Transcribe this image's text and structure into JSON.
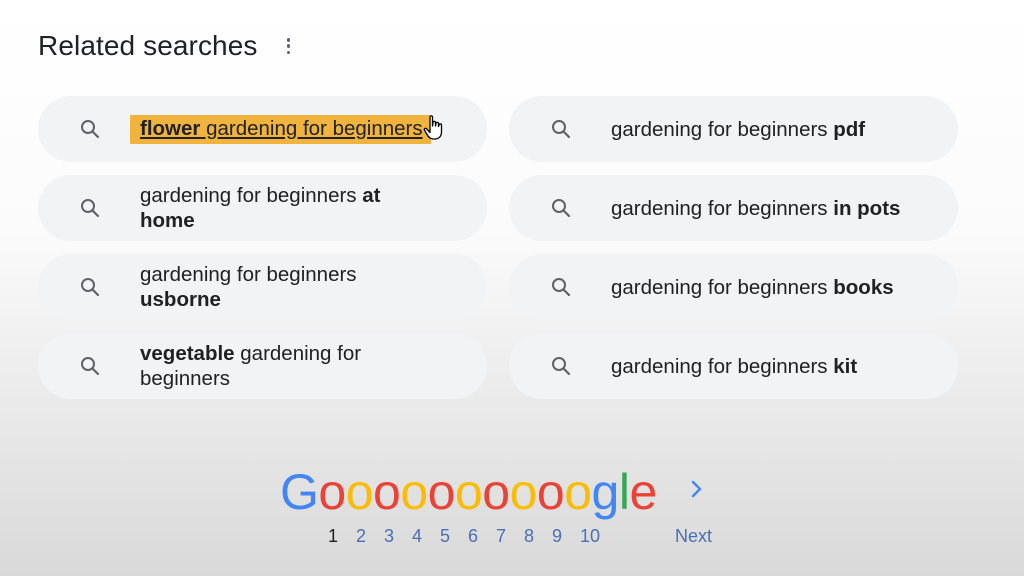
{
  "header": {
    "title": "Related searches"
  },
  "searches": [
    {
      "text": "flower gardening for beginners"
    },
    {
      "text": "gardening for beginners pdf"
    },
    {
      "text": "gardening for beginners at home"
    },
    {
      "text": "gardening for beginners in pots"
    },
    {
      "text": "gardening for beginners usborne"
    },
    {
      "text": "gardening for beginners books"
    },
    {
      "text": "vegetable gardening for beginners"
    },
    {
      "text": "gardening for beginners kit"
    }
  ],
  "pagination": {
    "logo": "Goooooooooogle",
    "pages": [
      "1",
      "2",
      "3",
      "4",
      "5",
      "6",
      "7",
      "8",
      "9",
      "10"
    ],
    "current_page": "1",
    "next_label": "Next"
  },
  "colors": {
    "highlight": "#f0b43e",
    "pill_background": "#f1f3f4",
    "link": "#4a6fb5",
    "google_blue": "#4285f4",
    "google_red": "#ea4335",
    "google_yellow": "#fbbc05",
    "google_green": "#34a853"
  }
}
